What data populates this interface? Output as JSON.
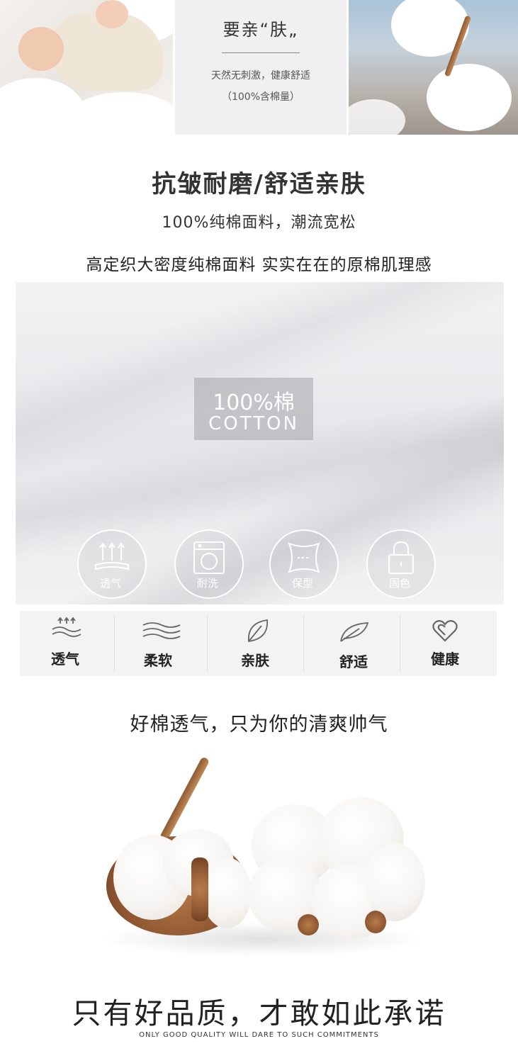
{
  "banner": {
    "title": "要亲“肤„",
    "subtitle": "天然无刺激，健康舒适",
    "note": "（100%含棉量）"
  },
  "headline": {
    "main": "抗皱耐磨/舒适亲肤",
    "sub": "100%纯棉面料，潮流宽松",
    "desc": "高定织大密度纯棉面料  实实在在的原棉肌理感"
  },
  "fabric": {
    "badge_line1": "100%棉",
    "badge_line2": "COTTON",
    "circles": [
      {
        "label": "透气",
        "icon": "breathable-icon"
      },
      {
        "label": "耐洗",
        "icon": "washing-machine-icon"
      },
      {
        "label": "保型",
        "icon": "shape-retention-icon"
      },
      {
        "label": "固色",
        "icon": "lock-icon"
      }
    ]
  },
  "features": [
    {
      "label": "透气",
      "icon": "breathable-waves-icon"
    },
    {
      "label": "柔软",
      "icon": "soft-waves-icon"
    },
    {
      "label": "亲肤",
      "icon": "leaf-icon"
    },
    {
      "label": "舒适",
      "icon": "feather-icon"
    },
    {
      "label": "健康",
      "icon": "heart-icon"
    }
  ],
  "cotton_section": {
    "heading": "好棉透气，只为你的清爽帅气"
  },
  "footer": {
    "promise": "只有好品质，才敢如此承诺",
    "promise_en": "ONLY GOOD QUALITY WILL DARE TO SUCH COMMITMENTS"
  }
}
